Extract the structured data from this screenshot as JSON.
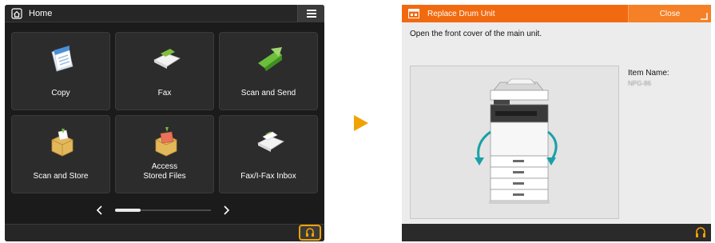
{
  "left_screen": {
    "title": "Home",
    "icons": {
      "home": "home-icon",
      "menu": "menu-icon",
      "counter": "counter-check-icon"
    },
    "tiles": [
      {
        "label": "Copy",
        "icon": "copy-icon"
      },
      {
        "label": "Fax",
        "icon": "fax-icon"
      },
      {
        "label": "Scan and Send",
        "icon": "scan-send-icon"
      },
      {
        "label": "Scan and Store",
        "icon": "scan-store-icon"
      },
      {
        "label": "Access\nStored Files",
        "icon": "access-stored-files-icon"
      },
      {
        "label": "Fax/I-Fax Inbox",
        "icon": "fax-inbox-icon"
      }
    ],
    "pager": {
      "prev": "chevron-left-icon",
      "next": "chevron-right-icon",
      "position": 0.25
    }
  },
  "transition_arrow": {
    "icon": "play-arrow-icon",
    "color": "#f2a200"
  },
  "right_screen": {
    "title": "Replace Drum Unit",
    "close_label": "Close",
    "instruction": "Open the front cover of the main unit.",
    "item_name_label": "Item Name:",
    "item_name_value": "NPG-86",
    "header_color": "#f26a10",
    "accent_arrow_color": "#1aa0a8"
  }
}
